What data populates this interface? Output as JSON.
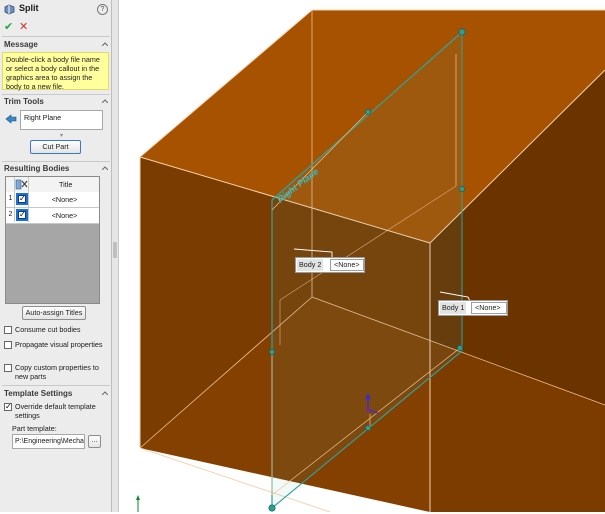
{
  "property_manager": {
    "title": "Split",
    "help_glyph": "?",
    "ok_glyph": "✔",
    "cancel_glyph": "✕",
    "message": {
      "header": "Message",
      "text": "Double-click a body file name or select a body callout in the graphics area to assign the body to a new file."
    },
    "trim_tools": {
      "header": "Trim Tools",
      "selection": "Right Plane",
      "cut_button": "Cut Part"
    },
    "resulting_bodies": {
      "header": "Resulting Bodies",
      "column_title": "Title",
      "rows": [
        {
          "num": "1",
          "checked": true,
          "title": "<None>"
        },
        {
          "num": "2",
          "checked": true,
          "title": "<None>"
        }
      ],
      "auto_assign_button": "Auto-assign Titles"
    },
    "options": [
      {
        "label": "Consume cut bodies",
        "checked": false
      },
      {
        "label": "Propagate visual properties",
        "checked": false
      },
      {
        "label": "Copy custom properties to new parts",
        "checked": false
      }
    ],
    "template_settings": {
      "header": "Template Settings",
      "override_label": "Override default template settings",
      "override_checked": true,
      "part_template_label": "Part template:",
      "part_template_value": "P:\\Engineering\\Mechanical",
      "browse_button": "..."
    }
  },
  "graphics": {
    "plane_label": "Right Plane",
    "callouts": [
      {
        "name": "Body 2",
        "value": "<None>"
      },
      {
        "name": "Body 1",
        "value": "<None>"
      }
    ],
    "colors": {
      "box_front": "#7a3c00",
      "box_top": "#a65200",
      "box_side": "#6b3300",
      "edge": "#f4c89a",
      "plane": "#2fa39c"
    }
  }
}
